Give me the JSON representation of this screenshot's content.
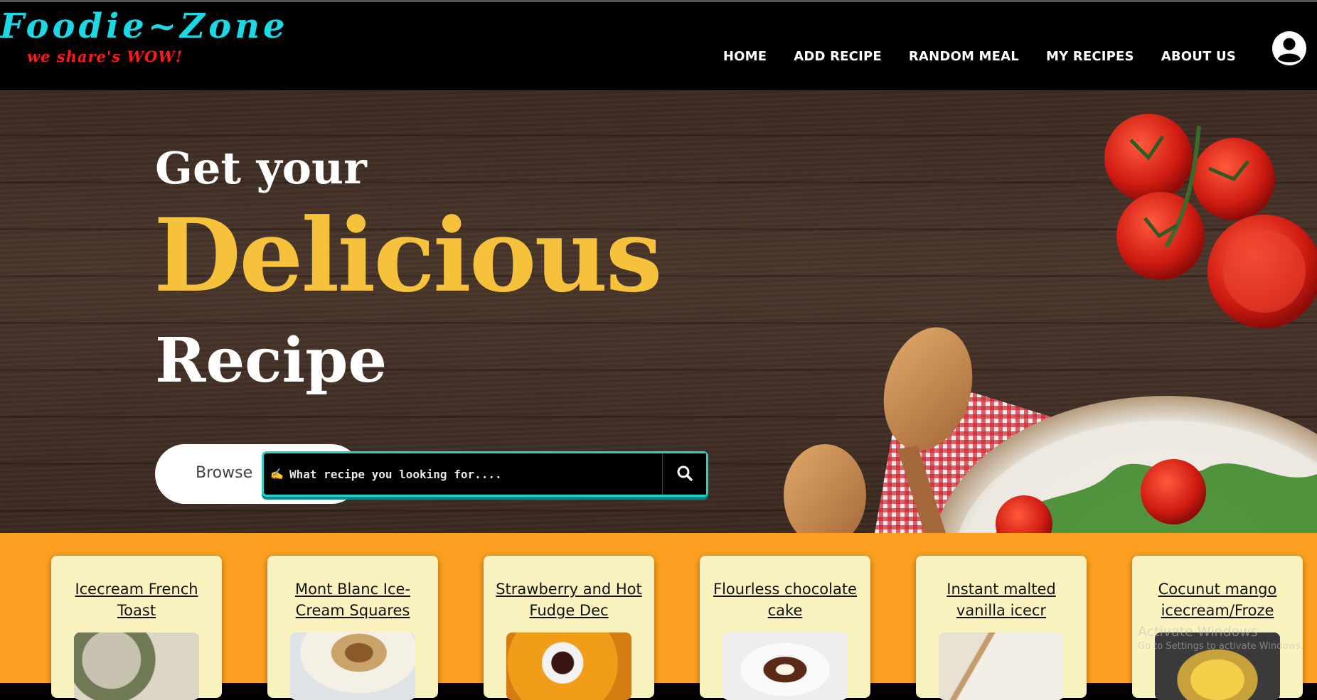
{
  "header": {
    "logo_title": "Foodie~Zone",
    "logo_tagline": "we share's WOW!",
    "nav": [
      "HOME",
      "ADD RECIPE",
      "RANDOM MEAL",
      "MY RECIPES",
      "ABOUT US"
    ],
    "user_icon": "user-circle-icon"
  },
  "hero": {
    "line1": "Get your",
    "line2": "Delicious",
    "line3": "Recipe",
    "browse_label": "Browse",
    "search_emoji": "✍",
    "search_placeholder": "What recipe you looking for....",
    "search_icon": "search-icon"
  },
  "cards": [
    {
      "title": "Icecream French Toast"
    },
    {
      "title": "Mont Blanc Ice-Cream Squares"
    },
    {
      "title": "Strawberry and Hot Fudge Dec"
    },
    {
      "title": "Flourless chocolate cake"
    },
    {
      "title": "Instant malted vanilla icecr"
    },
    {
      "title": "Cocunut mango icecream/Froze"
    }
  ],
  "watermark": {
    "line1": "Activate Windows",
    "line2": "Go to Settings to activate Windows."
  },
  "colors": {
    "logo_cyan": "#1ad8e4",
    "tagline_red": "#ff1a1a",
    "accent_yellow": "#f7c23b",
    "strip_orange": "#fc9e20",
    "card_cream": "#faf3c0",
    "search_border": "#22d3c8"
  }
}
